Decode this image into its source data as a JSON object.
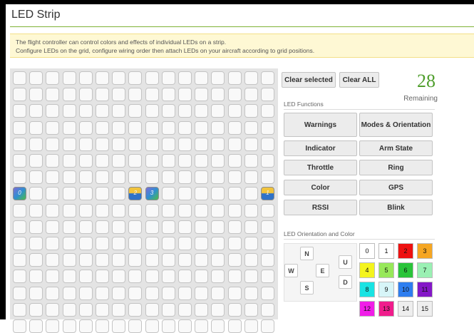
{
  "page": {
    "title": "LED Strip"
  },
  "note": {
    "line1": "The flight controller can control colors and effects of individual LEDs on a strip.",
    "line2": "Configure LEDs on the grid, configure wiring order then attach LEDs on your aircraft according to grid positions."
  },
  "grid": {
    "rows": 16,
    "cols": 16,
    "leds": [
      {
        "row": 7,
        "col": 0,
        "label": "0",
        "style": "rainbow"
      },
      {
        "row": 7,
        "col": 7,
        "label": "2",
        "style": "amber"
      },
      {
        "row": 7,
        "col": 8,
        "label": "3",
        "style": "rainbow"
      },
      {
        "row": 7,
        "col": 15,
        "label": "1",
        "style": "amber"
      }
    ]
  },
  "controls": {
    "clear_selected": "Clear selected",
    "clear_all": "Clear ALL",
    "remaining_count": "28",
    "remaining_label": "Remaining"
  },
  "functions": {
    "heading": "LED Functions",
    "items": [
      {
        "id": "warnings",
        "label": "Warnings"
      },
      {
        "id": "modes-orientation",
        "label": "Modes & Orientation"
      },
      {
        "id": "indicator",
        "label": "Indicator"
      },
      {
        "id": "arm-state",
        "label": "Arm State"
      },
      {
        "id": "throttle",
        "label": "Throttle"
      },
      {
        "id": "ring",
        "label": "Ring"
      },
      {
        "id": "color",
        "label": "Color"
      },
      {
        "id": "gps",
        "label": "GPS"
      },
      {
        "id": "rssi",
        "label": "RSSI"
      },
      {
        "id": "blink",
        "label": "Blink"
      }
    ]
  },
  "orientation": {
    "heading": "LED Orientation and Color",
    "directions": {
      "n": "N",
      "w": "W",
      "e": "E",
      "s": "S",
      "u": "U",
      "d": "D"
    }
  },
  "colors": [
    {
      "label": "0",
      "hex": "#ffffff"
    },
    {
      "label": "1",
      "hex": "#ffffff"
    },
    {
      "label": "2",
      "hex": "#ee1111"
    },
    {
      "label": "3",
      "hex": "#f5a623"
    },
    {
      "label": "4",
      "hex": "#f4f41d"
    },
    {
      "label": "5",
      "hex": "#98e85a"
    },
    {
      "label": "6",
      "hex": "#2ac43a"
    },
    {
      "label": "7",
      "hex": "#9af0b3"
    },
    {
      "label": "8",
      "hex": "#19e3e3"
    },
    {
      "label": "9",
      "hex": "#d7f5f8"
    },
    {
      "label": "10",
      "hex": "#2e7ef0"
    },
    {
      "label": "11",
      "hex": "#8418c7"
    },
    {
      "label": "12",
      "hex": "#f01de8"
    },
    {
      "label": "13",
      "hex": "#f01d8c"
    },
    {
      "label": "14",
      "hex": "#eeeeee"
    },
    {
      "label": "15",
      "hex": "#eeeeee"
    }
  ]
}
